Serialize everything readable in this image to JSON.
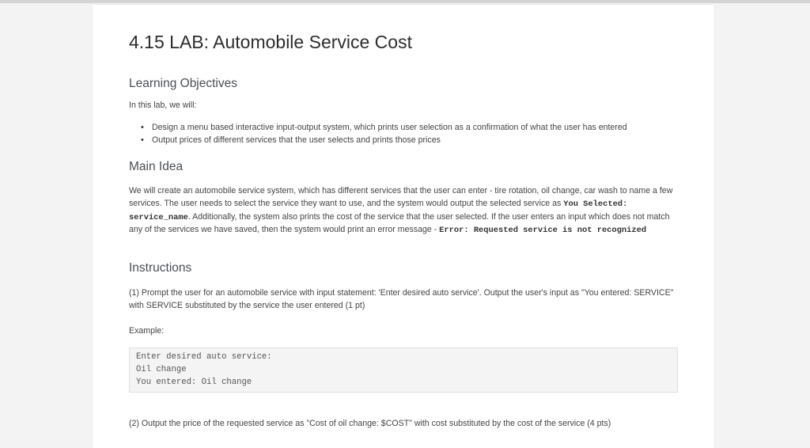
{
  "title": "4.15 LAB: Automobile Service Cost",
  "learning_objectives": {
    "heading": "Learning Objectives",
    "intro": "In this lab, we will:",
    "bullets": [
      "Design a menu based interactive input-output system, which prints user selection as a confirmation of what the user has entered",
      "Output prices of different services that the user selects and prints those prices"
    ]
  },
  "main_idea": {
    "heading": "Main Idea",
    "text_1": "We will create an automobile service system, which has different services that the user can enter - tire rotation, oil change, car wash to name a few services. The user needs to select the service they want to use, and the system would output the selected service as ",
    "code_1": "You Selected: service_name",
    "text_2": ". Additionally, the system also prints the cost of the service that the user selected. If the user enters an input which does not match any of the services we have saved, then the system would print an error message - ",
    "code_2": "Error: Requested service is not recognized"
  },
  "instructions": {
    "heading": "Instructions",
    "step1": "(1) Prompt the user for an automobile service with input statement: 'Enter desired auto service'. Output the user's input as \"You entered: SERVICE\" with SERVICE substituted by the service the user entered (1 pt)",
    "example_label": "Example:",
    "example_lines": [
      "Enter desired auto service:",
      "Oil change",
      "You entered: Oil change"
    ],
    "step2": "(2) Output the price of the requested service as \"Cost of oil change: $COST\" with cost substituted by the cost of the service (4 pts)"
  }
}
